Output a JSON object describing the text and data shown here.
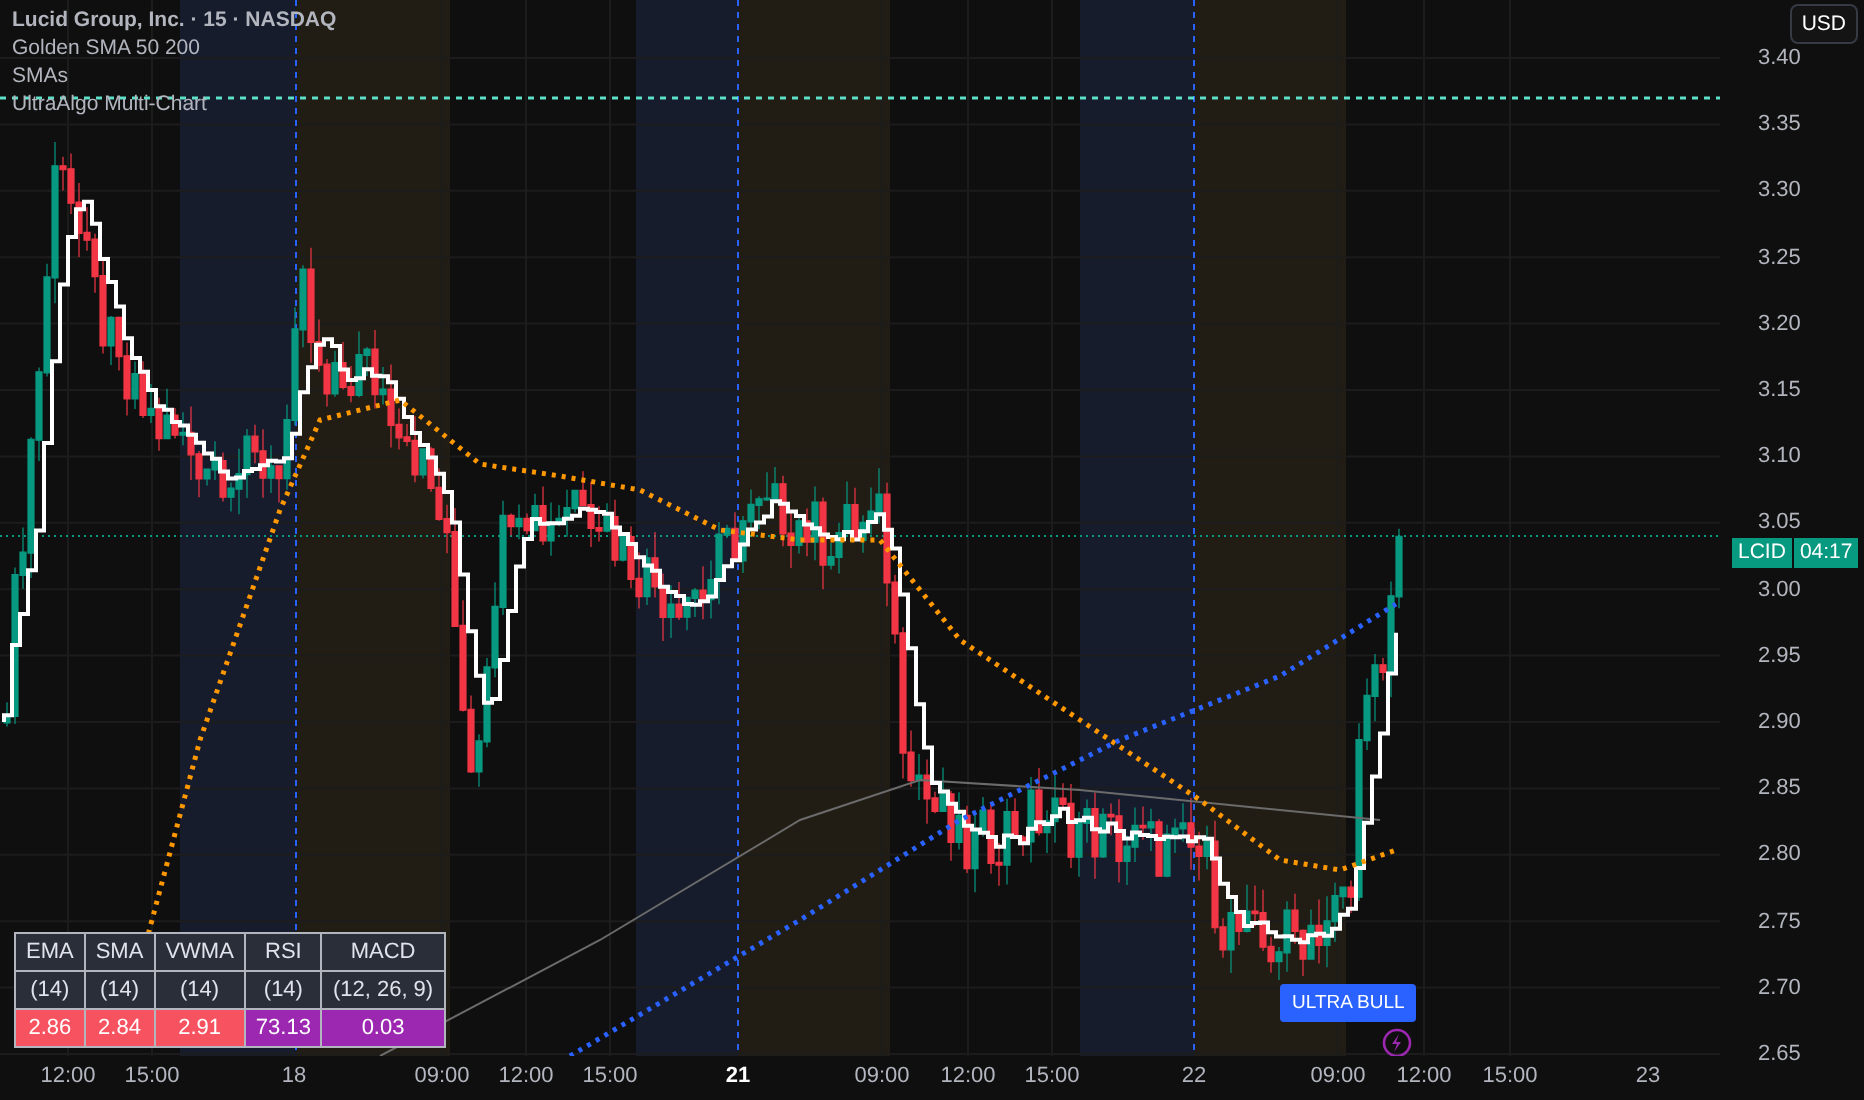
{
  "legend": {
    "title": "Lucid Group, Inc. · 15 · NASDAQ",
    "indicators": [
      "Golden SMA 50 200",
      "SMAs",
      "UltraAlgo Multi-Chart"
    ]
  },
  "currency_button": "USD",
  "price_axis": {
    "ticks": [
      "3.40",
      "3.35",
      "3.30",
      "3.25",
      "3.20",
      "3.15",
      "3.10",
      "3.05",
      "3.00",
      "2.95",
      "2.90",
      "2.85",
      "2.80",
      "2.75",
      "2.70",
      "2.65"
    ]
  },
  "price_tag": {
    "symbol": "LCID",
    "countdown": "04:17"
  },
  "time_axis": {
    "labels": [
      {
        "text": "12:00",
        "emphasized": false
      },
      {
        "text": "15:00",
        "emphasized": false
      },
      {
        "text": "18",
        "emphasized": false
      },
      {
        "text": "09:00",
        "emphasized": false
      },
      {
        "text": "12:00",
        "emphasized": false
      },
      {
        "text": "15:00",
        "emphasized": false
      },
      {
        "text": "21",
        "emphasized": true
      },
      {
        "text": "09:00",
        "emphasized": false
      },
      {
        "text": "12:00",
        "emphasized": false
      },
      {
        "text": "15:00",
        "emphasized": false
      },
      {
        "text": "22",
        "emphasized": false
      },
      {
        "text": "09:00",
        "emphasized": false
      },
      {
        "text": "12:00",
        "emphasized": false
      },
      {
        "text": "15:00",
        "emphasized": false
      },
      {
        "text": "23",
        "emphasized": false
      }
    ]
  },
  "signal_label": "ULTRA BULL",
  "indicator_table": {
    "columns": [
      {
        "name": "EMA",
        "period": "(14)",
        "value": "2.86",
        "color": "#f7525f"
      },
      {
        "name": "SMA",
        "period": "(14)",
        "value": "2.84",
        "color": "#f7525f"
      },
      {
        "name": "VWMA",
        "period": "(14)",
        "value": "2.91",
        "color": "#f7525f"
      },
      {
        "name": "RSI",
        "period": "(14)",
        "value": "73.13",
        "color": "#9c27b0"
      },
      {
        "name": "MACD",
        "period": "(12, 26, 9)",
        "value": "0.03",
        "color": "#9c27b0"
      }
    ]
  }
}
